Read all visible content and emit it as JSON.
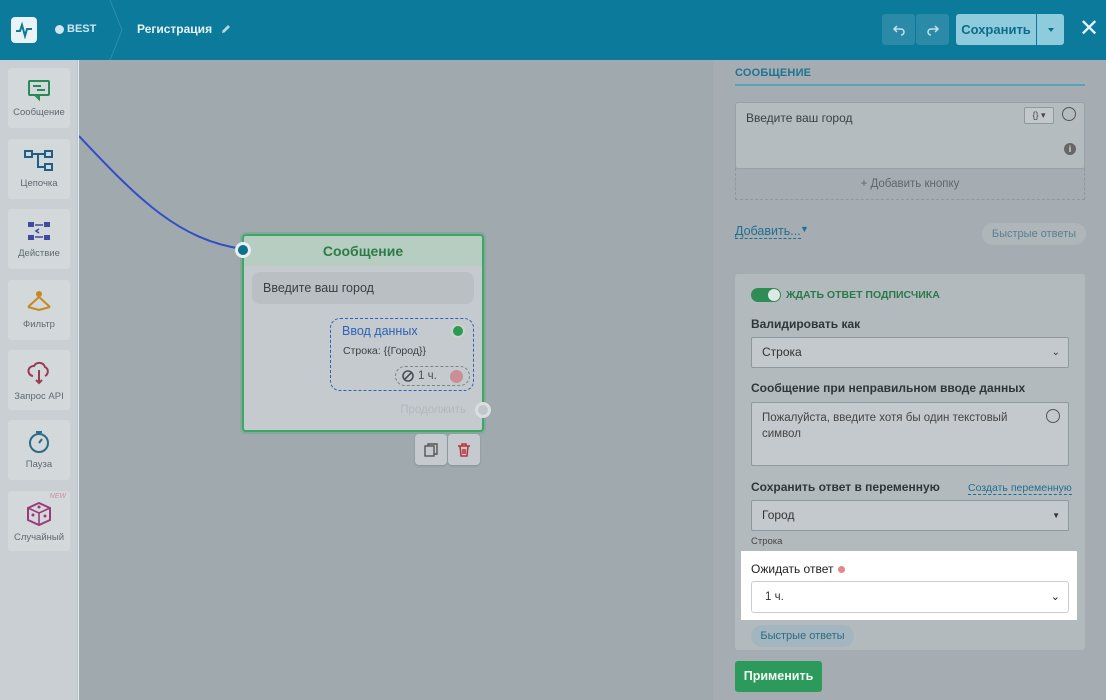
{
  "header": {
    "brand": "BEST",
    "title": "Регистрация",
    "save_label": "Сохранить",
    "close_glyph": "✕"
  },
  "toolbar": {
    "items": [
      {
        "label": "Сообщение",
        "icon": "message-icon",
        "color": "#2a8a57"
      },
      {
        "label": "Цепочка",
        "icon": "chain-icon",
        "color": "#1f5f86"
      },
      {
        "label": "Действие",
        "icon": "action-icon",
        "color": "#3f4aa0"
      },
      {
        "label": "Фильтр",
        "icon": "filter-icon",
        "color": "#c48a20"
      },
      {
        "label": "Запрос API",
        "icon": "api-icon",
        "color": "#9b3a55"
      },
      {
        "label": "Пауза",
        "icon": "timer-icon",
        "color": "#2c6a87"
      },
      {
        "label": "Случайный",
        "icon": "dice-icon",
        "color": "#9b3a7a",
        "badge": "NEW"
      }
    ]
  },
  "node": {
    "title": "Сообщение",
    "message": "Введите ваш город",
    "input_title": "Ввод данных",
    "input_sub": "Строка: {{Город}}",
    "timeout": "1 ч.",
    "continue": "Продолжить"
  },
  "panel": {
    "section_title": "СООБЩЕНИЕ",
    "message_text": "Введите ваш город",
    "var_btn": "{}",
    "add_button": "+ Добавить кнопку",
    "add_link": "Добавить...",
    "quick_replies": "Быстрые ответы",
    "wait_reply": "ЖДАТЬ ОТВЕТ ПОДПИСЧИКА",
    "validate_label": "Валидировать как",
    "validate_value": "Строка",
    "error_label": "Сообщение при неправильном вводе данных",
    "error_text": "Пожалуйста, введите хотя бы один текстовый символ",
    "save_var_label": "Сохранить ответ в переменную",
    "create_var": "Создать переменную",
    "var_value": "Город",
    "var_hint": "Строка",
    "wait_label": "Ожидать ответ",
    "wait_value": "1 ч.",
    "quick_replies_2": "Быстрые ответы",
    "apply": "Применить"
  },
  "colors": {
    "header": "#0b7a9b",
    "accent_green": "#2c9a5a",
    "link_blue": "#1f6f90",
    "required_dot": "#e5868f"
  }
}
